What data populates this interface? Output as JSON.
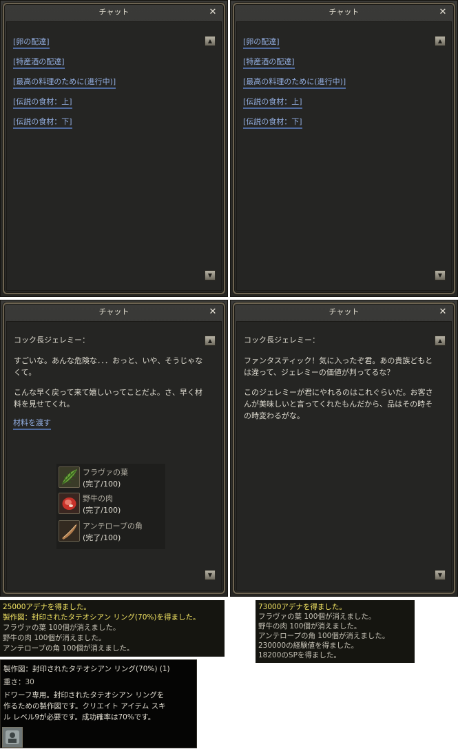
{
  "windows": [
    {
      "title": "チャット",
      "close": "✕",
      "quest_links": [
        "[卵の配達]",
        "[特産酒の配達]",
        "[最高の料理のために(進行中)]",
        "[伝説の食材：上]",
        "[伝説の食材：下]"
      ]
    },
    {
      "title": "チャット",
      "close": "✕",
      "quest_links": [
        "[卵の配達]",
        "[特産酒の配達]",
        "[最高の料理のために(進行中)]",
        "[伝説の食材：上]",
        "[伝説の食材：下]"
      ]
    },
    {
      "title": "チャット",
      "close": "✕",
      "npc": "コック長ジェレミー：",
      "paragraphs": [
        "すごいな。あんな危険な．．．おっと、いや、そうじゃなくて。",
        "こんな早く戻って来て嬉しいってことだよ。さ、早く材料を見せてくれ。"
      ],
      "action_link": "材料を渡す",
      "required_items": [
        {
          "icon": "leaf-icon",
          "name": "フラヴァの葉",
          "status": "(完了/100)"
        },
        {
          "icon": "meat-icon",
          "name": "野牛の肉",
          "status": "(完了/100)"
        },
        {
          "icon": "horn-icon",
          "name": "アンテロープの角",
          "status": "(完了/100)"
        }
      ]
    },
    {
      "title": "チャット",
      "close": "✕",
      "npc": "コック長ジェレミー：",
      "paragraphs": [
        "ファンタスティック！気に入ったぞ君。あの貴族どもとは違って、ジェレミーの価値が判ってるな？",
        "このジェレミーが君にやれるのはこれぐらいだ。お客さんが美味しいと言ってくれたもんだから、品はその時その時変わるがな。"
      ]
    }
  ],
  "log_left": [
    {
      "text": "25000アデナを得ました。",
      "color": "y"
    },
    {
      "text": "製作図：封印されたタテオシアン リング(70%)を得ました。",
      "color": "y"
    },
    {
      "text": "フラヴァの葉 100個が消えました。",
      "color": "g"
    },
    {
      "text": "野牛の肉 100個が消えました。",
      "color": "g"
    },
    {
      "text": "アンテロープの角 100個が消えました。",
      "color": "g"
    }
  ],
  "log_right": [
    {
      "text": "73000アデナを得ました。",
      "color": "y"
    },
    {
      "text": "フラヴァの葉 100個が消えました。",
      "color": "g"
    },
    {
      "text": "野牛の肉 100個が消えました。",
      "color": "g"
    },
    {
      "text": "アンテロープの角 100個が消えました。",
      "color": "g"
    },
    {
      "text": "230000の経験値を得ました。",
      "color": "g"
    },
    {
      "text": "18200のSPを得ました。",
      "color": "g"
    }
  ],
  "tooltip": {
    "title": "製作図：封印されたタテオシアン リング(70%) (1)",
    "weight": "重さ：30",
    "desc": [
      "ドワーフ専用。封印されたタテオシアン リングを",
      "作るための製作図です。クリエイト アイテム スキ",
      "ル レベル9が必要です。成功確率は70%です。"
    ]
  },
  "icons": {
    "scroll_up": "▲",
    "scroll_down": "▼"
  },
  "colors": {
    "link": "#94b0e4",
    "system_yellow": "#f4e664",
    "window_bg": "#252523"
  }
}
